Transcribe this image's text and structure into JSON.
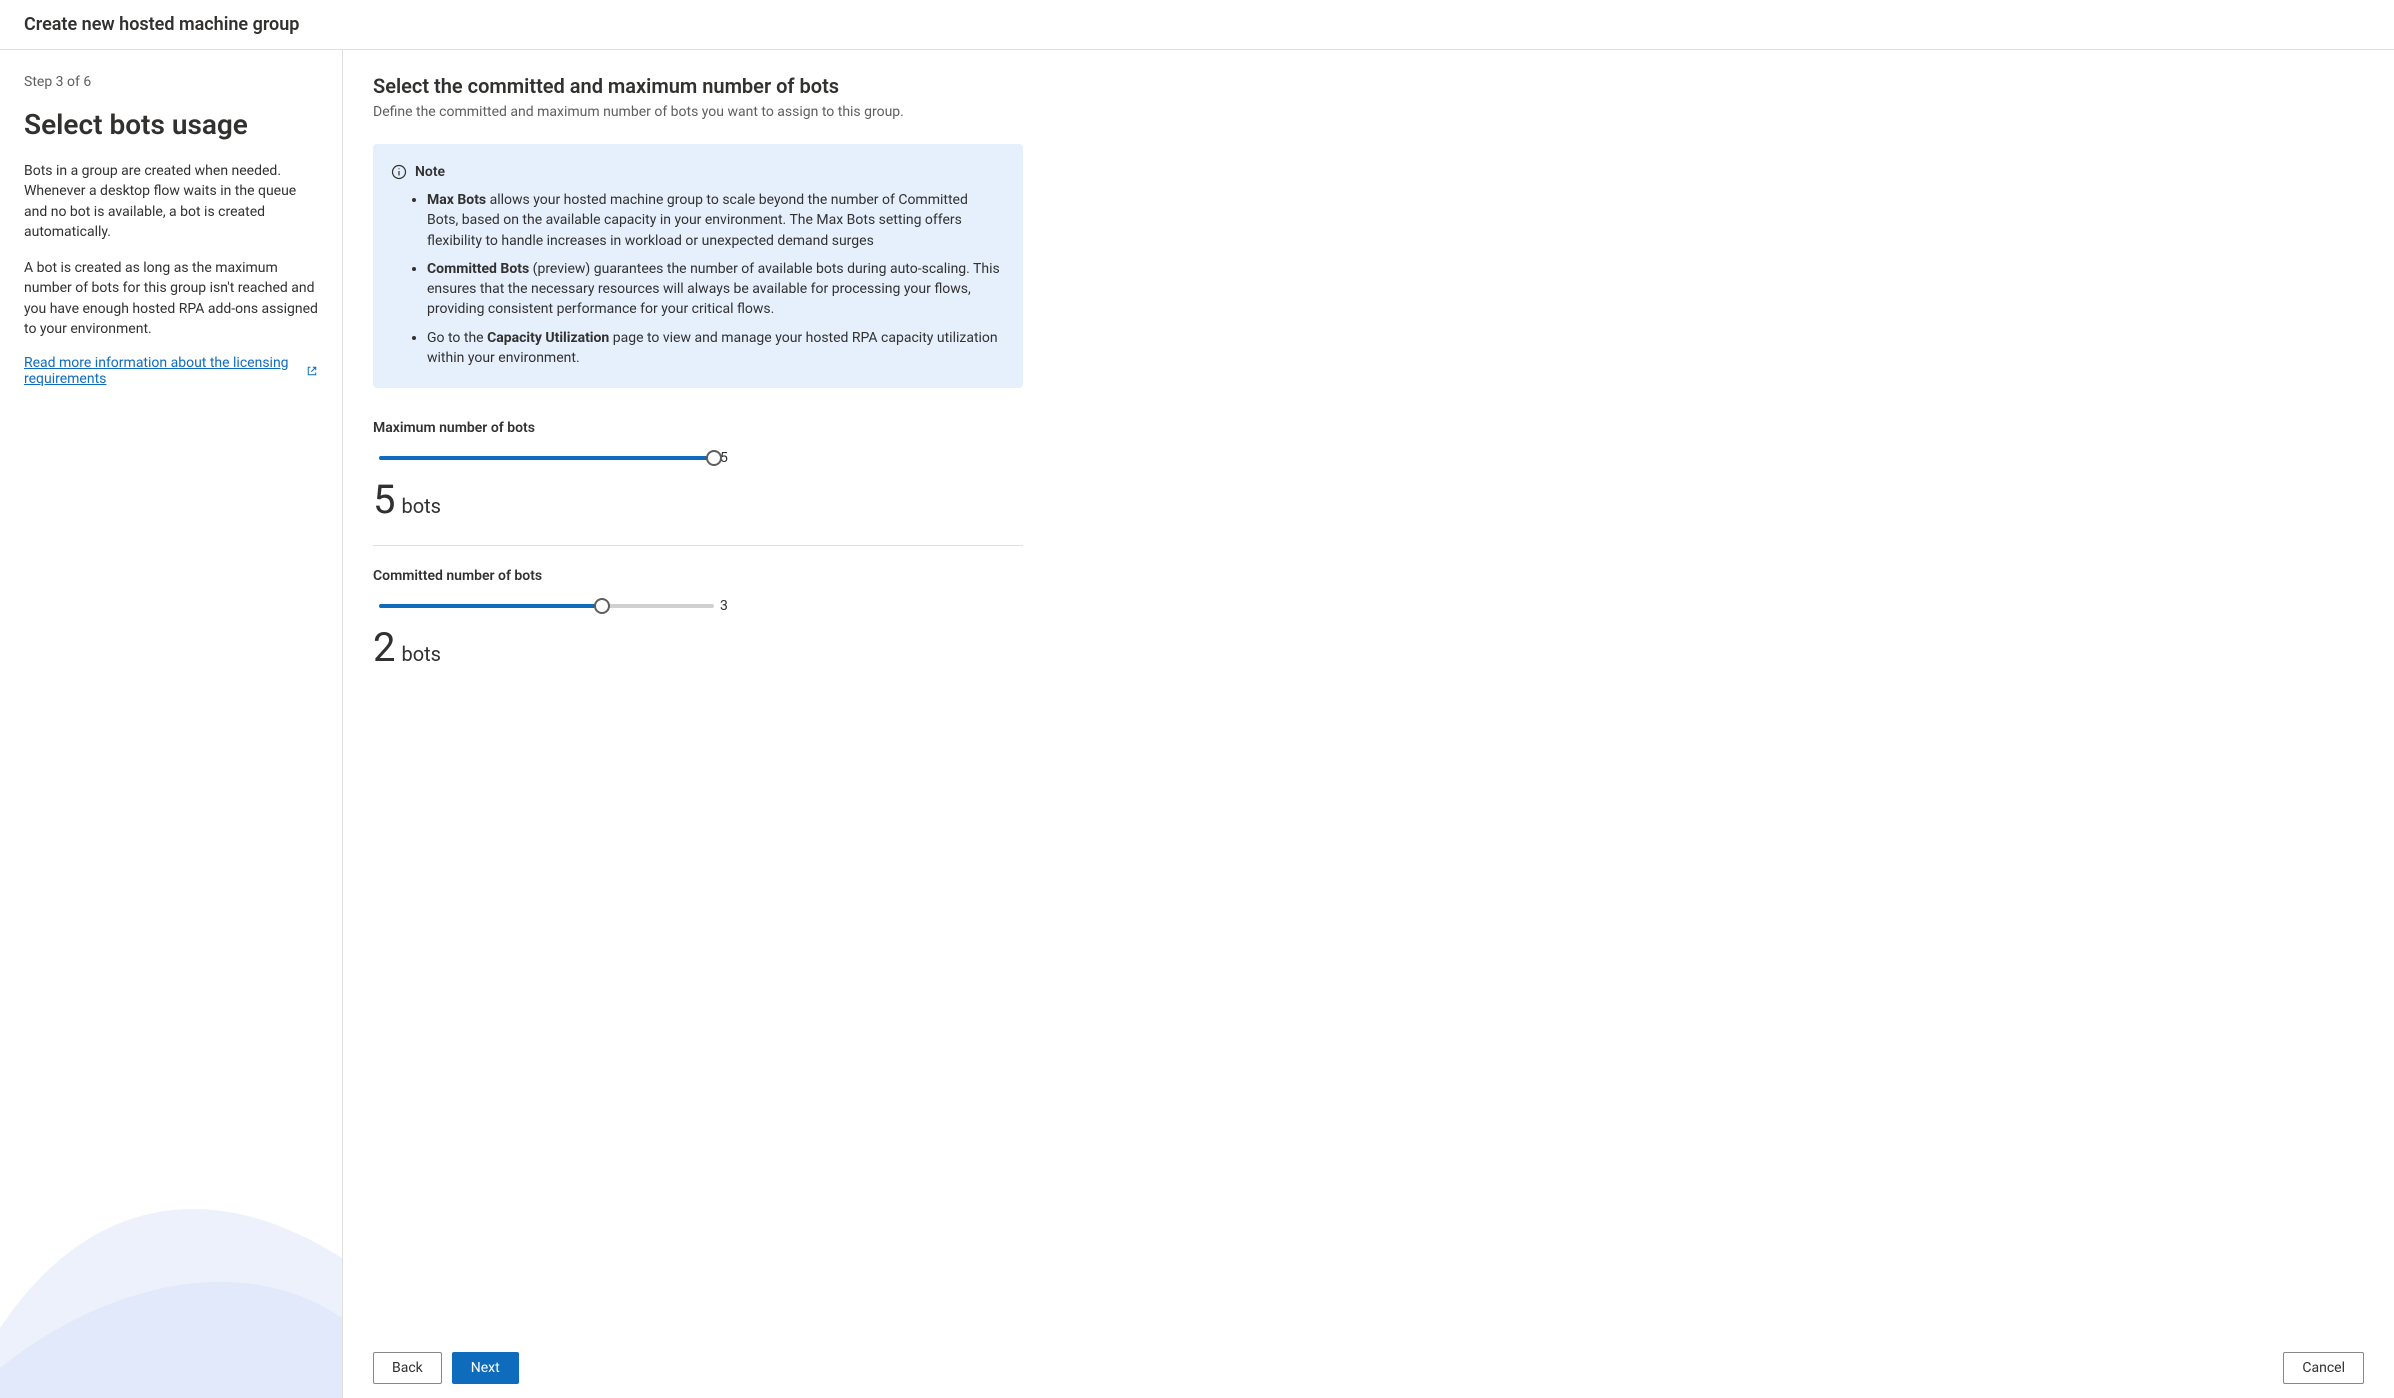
{
  "header": {
    "title": "Create new hosted machine group"
  },
  "sidebar": {
    "step_text": "Step 3 of 6",
    "title": "Select bots usage",
    "paragraph1": "Bots in a group are created when needed. Whenever a desktop flow waits in the queue and no bot is available, a bot is created automatically.",
    "paragraph2": "A bot is created as long as the maximum number of bots for this group isn't reached and you have enough hosted RPA add-ons assigned to your environment.",
    "link_text": "Read more information about the licensing requirements"
  },
  "main": {
    "title": "Select the committed and maximum number of bots",
    "subtitle": "Define the committed and maximum number of bots you want to assign to this group.",
    "note": {
      "label": "Note",
      "items": [
        {
          "bold": "Max Bots",
          "rest": " allows your hosted machine group to scale beyond the number of Committed Bots, based on the available capacity in your environment. The Max Bots setting offers flexibility to handle increases in workload or unexpected demand surges"
        },
        {
          "bold": "Committed Bots",
          "rest": " (preview) guarantees the number of available bots during auto-scaling. This ensures that the necessary resources will always be available for processing your flows, providing consistent performance for your critical flows."
        },
        {
          "prefix": "Go to the ",
          "bold": "Capacity Utilization",
          "rest": " page to view and manage your hosted RPA capacity utilization within your environment."
        }
      ]
    },
    "max_bots": {
      "label": "Maximum number of bots",
      "value": 5,
      "max": 5,
      "unit": "bots"
    },
    "committed_bots": {
      "label": "Committed number of bots",
      "value": 2,
      "max": 3,
      "unit": "bots"
    }
  },
  "footer": {
    "back": "Back",
    "next": "Next",
    "cancel": "Cancel"
  }
}
